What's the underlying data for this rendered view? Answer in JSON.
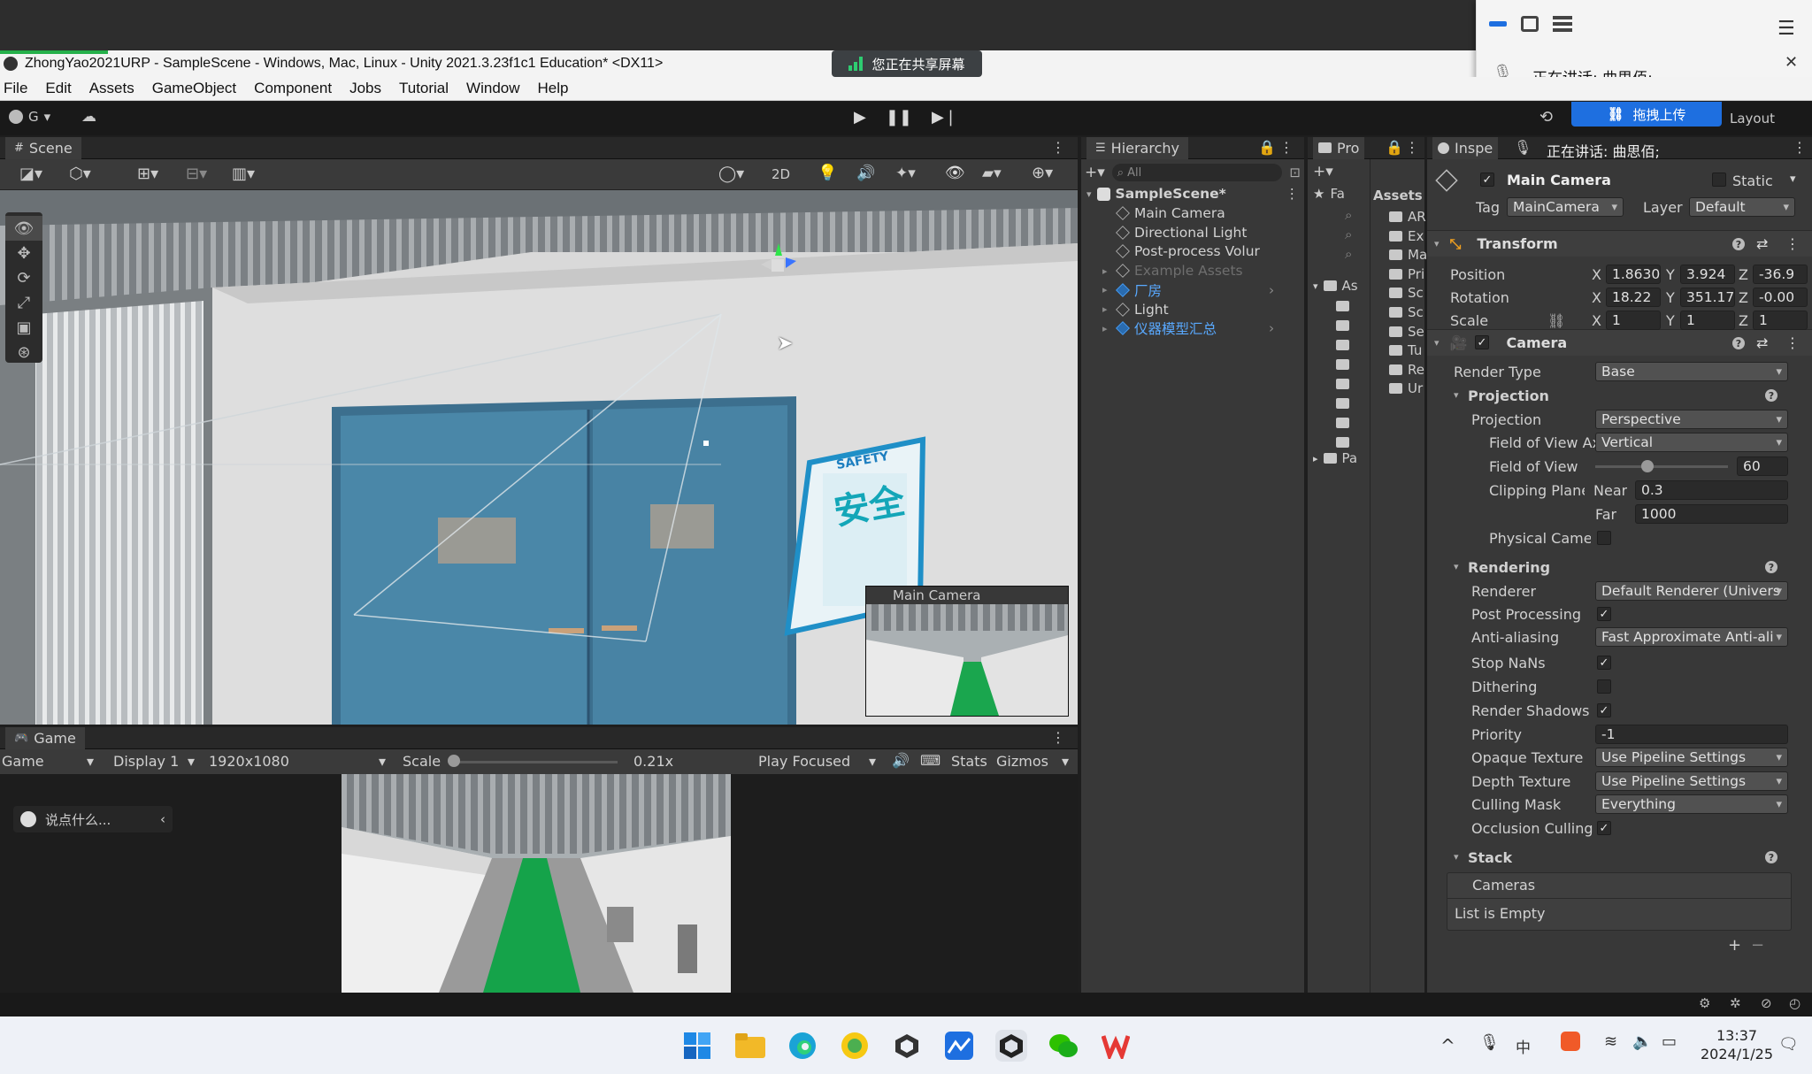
{
  "titlebar": {
    "title": "ZhongYao2021URP - SampleScene - Windows, Mac, Linux - Unity 2021.3.23f1c1 Education* <DX11>"
  },
  "share_banner": {
    "text": "您正在共享屏幕"
  },
  "call_overlay": {
    "speaking": "正在讲话:  曲思佰;",
    "upload_button": "拖拽上传"
  },
  "menubar": [
    "File",
    "Edit",
    "Assets",
    "GameObject",
    "Component",
    "Jobs",
    "Tutorial",
    "Window",
    "Help"
  ],
  "toolbar": {
    "account": "G",
    "layout": "Layout"
  },
  "scene": {
    "tab": "Scene",
    "mode_2d": "2D",
    "poster_title": "SAFETY",
    "poster_big": "安全",
    "camera_preview_title": "Main Camera"
  },
  "game": {
    "tab": "Game",
    "mode": "Game",
    "display": "Display 1",
    "resolution": "1920x1080",
    "scale_label": "Scale",
    "scale_value": "0.21x",
    "play_focused": "Play Focused",
    "stats": "Stats",
    "gizmos": "Gizmos",
    "chat_placeholder": "说点什么..."
  },
  "hierarchy": {
    "tab": "Hierarchy",
    "search_placeholder": "All",
    "scene_name": "SampleScene*",
    "items": [
      {
        "label": "Main Camera",
        "indent": 1,
        "color": "#d2d2d2",
        "prefab": false
      },
      {
        "label": "Directional Light",
        "indent": 1,
        "color": "#d2d2d2",
        "prefab": false
      },
      {
        "label": "Post-process Volur",
        "indent": 1,
        "color": "#d2d2d2",
        "prefab": false
      },
      {
        "label": "Example Assets",
        "indent": 1,
        "color": "#6e6e6e",
        "prefab": false
      },
      {
        "label": "厂房",
        "indent": 1,
        "color": "#59a9ff",
        "prefab": true
      },
      {
        "label": "Light",
        "indent": 1,
        "color": "#d2d2d2",
        "prefab": false
      },
      {
        "label": "仪器模型汇总",
        "indent": 1,
        "color": "#59a9ff",
        "prefab": true
      }
    ]
  },
  "project": {
    "tab": "Pro",
    "favorites": "Fa",
    "assets_header": "Assets",
    "assets_tree": "As",
    "packages": "Pa",
    "asset_items": [
      "AR",
      "Ex",
      "Ma",
      "Pri",
      "Sc",
      "Sc",
      "Se",
      "Tu",
      "Re",
      "Ur"
    ]
  },
  "inspector": {
    "tab": "Inspe",
    "object_name": "Main Camera",
    "static_label": "Static",
    "tag_label": "Tag",
    "tag_value": "MainCamera",
    "layer_label": "Layer",
    "layer_value": "Default",
    "transform": {
      "title": "Transform",
      "position_label": "Position",
      "rotation_label": "Rotation",
      "scale_label": "Scale",
      "position": {
        "x": "1.8630",
        "y": "3.924",
        "z": "-36.9"
      },
      "rotation": {
        "x": "18.22",
        "y": "351.17",
        "z": "-0.00"
      },
      "scale": {
        "x": "1",
        "y": "1",
        "z": "1"
      }
    },
    "camera": {
      "title": "Camera",
      "render_type_label": "Render Type",
      "render_type": "Base",
      "projection_section": "Projection",
      "projection_label": "Projection",
      "projection": "Perspective",
      "fov_axis_label": "Field of View Ax",
      "fov_axis": "Vertical",
      "fov_label": "Field of View",
      "fov_value": "60",
      "fov_slider_fraction": 0.39,
      "clip_label": "Clipping Planes",
      "near_label": "Near",
      "near_value": "0.3",
      "far_label": "Far",
      "far_value": "1000",
      "physical_label": "Physical Camer",
      "rendering_section": "Rendering",
      "renderer_label": "Renderer",
      "renderer": "Default Renderer (Univers",
      "post_processing_label": "Post Processing",
      "anti_aliasing_label": "Anti-aliasing",
      "anti_aliasing": "Fast Approximate Anti-ali",
      "stop_nans_label": "Stop NaNs",
      "dithering_label": "Dithering",
      "render_shadows_label": "Render Shadows",
      "priority_label": "Priority",
      "priority_value": "-1",
      "opaque_label": "Opaque Texture",
      "opaque_value": "Use Pipeline Settings",
      "depth_label": "Depth Texture",
      "depth_value": "Use Pipeline Settings",
      "culling_label": "Culling Mask",
      "culling_value": "Everything",
      "occlusion_label": "Occlusion Culling",
      "stack_section": "Stack",
      "cameras_label": "Cameras",
      "list_empty": "List is Empty"
    }
  },
  "taskbar": {
    "time": "13:37",
    "date": "2024/1/25",
    "ime": "中"
  },
  "icons": [
    "windows-start-icon",
    "file-explorer-icon",
    "edge-icon",
    "sunflower-icon",
    "unity-hub-icon",
    "maps-icon",
    "unity-icon",
    "wechat-icon",
    "wps-icon"
  ]
}
